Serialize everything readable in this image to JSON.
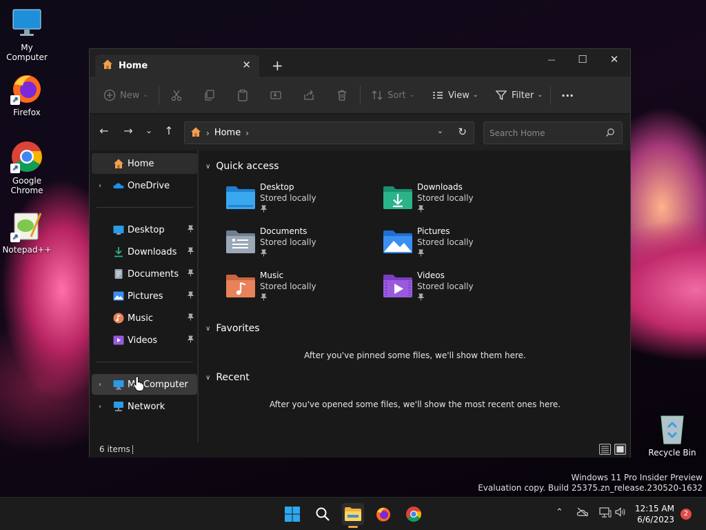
{
  "desktop": {
    "icons": [
      {
        "label": "My Computer"
      },
      {
        "label": "Firefox",
        "shortcut": "↗"
      },
      {
        "label": "Google Chrome",
        "shortcut": "↗"
      },
      {
        "label": "Notepad++",
        "shortcut": "↗"
      },
      {
        "label": "Recycle Bin"
      }
    ]
  },
  "window": {
    "tab": {
      "icon": "home-icon",
      "label": "Home",
      "close": "✕"
    },
    "new_tab": "+",
    "controls": {
      "minimize": "—",
      "maximize": "☐",
      "close": "✕"
    },
    "toolbar": {
      "new_label": "New",
      "sort_label": "Sort",
      "view_label": "View",
      "filter_label": "Filter",
      "more_label": "···",
      "caret": "⌄"
    },
    "nav": {
      "back": "←",
      "forward": "→",
      "recent": "⌄",
      "up": "↑"
    },
    "address": {
      "crumb": "Home",
      "sep": "›",
      "dropdown": "⌄",
      "refresh": "↻"
    },
    "search": {
      "placeholder": "Search Home"
    },
    "sidebar": {
      "chevron": "›",
      "pin": "📌",
      "top": [
        {
          "label": "Home",
          "icon": "home-icon"
        },
        {
          "label": "OneDrive",
          "icon": "cloud-icon"
        }
      ],
      "pinned": [
        {
          "label": "Desktop",
          "icon": "desktop-folder-icon"
        },
        {
          "label": "Downloads",
          "icon": "downloads-icon"
        },
        {
          "label": "Documents",
          "icon": "documents-icon"
        },
        {
          "label": "Pictures",
          "icon": "pictures-icon"
        },
        {
          "label": "Music",
          "icon": "music-icon"
        },
        {
          "label": "Videos",
          "icon": "videos-icon"
        }
      ],
      "bottom": [
        {
          "label": "My Computer",
          "icon": "computer-icon"
        },
        {
          "label": "Network",
          "icon": "network-icon"
        }
      ]
    },
    "content": {
      "collapse_arrow": "∨",
      "quick_access_title": "Quick access",
      "quick_access": [
        {
          "name": "Desktop",
          "status": "Stored locally",
          "color": "#3aa0e8"
        },
        {
          "name": "Downloads",
          "status": "Stored locally",
          "color": "#2bb38a"
        },
        {
          "name": "Documents",
          "status": "Stored locally",
          "color": "#8a9bb0"
        },
        {
          "name": "Pictures",
          "status": "Stored locally",
          "color": "#3a8ff0"
        },
        {
          "name": "Music",
          "status": "Stored locally",
          "color": "#e8825a"
        },
        {
          "name": "Videos",
          "status": "Stored locally",
          "color": "#9a5ae0"
        }
      ],
      "favorites_title": "Favorites",
      "favorites_empty": "After you've pinned some files, we'll show them here.",
      "recent_title": "Recent",
      "recent_empty": "After you've opened some files, we'll show the most recent ones here."
    },
    "status": {
      "count": "6 items"
    }
  },
  "watermark": {
    "line1": "Windows 11 Pro Insider Preview",
    "line2": "Evaluation copy. Build 25375.zn_release.230520-1632"
  },
  "taskbar": {
    "tray_chevron": "⌃",
    "time": "12:15 AM",
    "date": "6/6/2023",
    "notifications": "2"
  }
}
